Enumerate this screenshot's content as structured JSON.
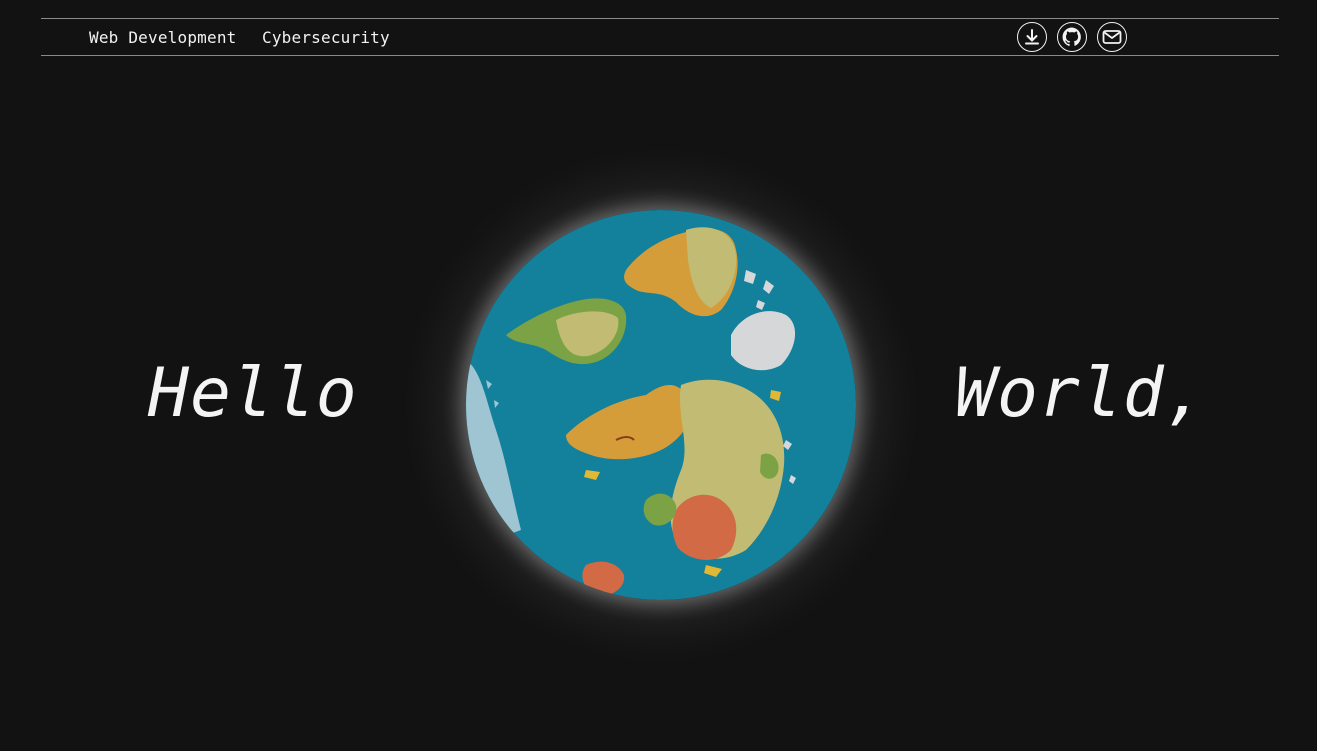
{
  "nav": {
    "links": [
      {
        "label": "Web Development"
      },
      {
        "label": "Cybersecurity"
      }
    ],
    "icons": [
      {
        "name": "download-icon"
      },
      {
        "name": "github-icon"
      },
      {
        "name": "mail-icon"
      }
    ]
  },
  "hero": {
    "left_word": "Hello",
    "right_word": "World,"
  },
  "colors": {
    "background": "#121212",
    "ocean": "#13809c",
    "land_green": "#7ba245",
    "land_khaki": "#c1bb73",
    "land_orange": "#d59d3a",
    "land_red": "#d16a45",
    "land_yellow": "#e0b833",
    "ice": "#d6d7d9"
  }
}
